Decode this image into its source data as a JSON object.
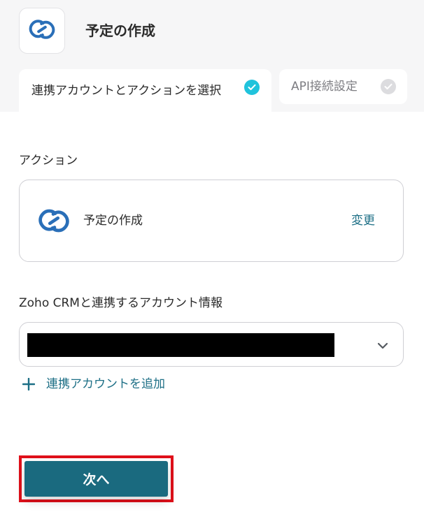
{
  "header": {
    "app_icon": "zoho-crm-icon",
    "title": "予定の作成"
  },
  "tabs": [
    {
      "label": "連携アカウントとアクションを選択",
      "state": "completed",
      "icon": "check-icon"
    },
    {
      "label": "API接続設定",
      "state": "pending",
      "icon": "check-icon"
    }
  ],
  "action_section": {
    "label": "アクション",
    "card": {
      "icon": "zoho-crm-icon",
      "action_name": "予定の作成",
      "change_label": "変更"
    }
  },
  "account_section": {
    "label": "Zoho CRMと連携するアカウント情報",
    "select": {
      "value_redacted": true,
      "icon": "chevron-down-icon"
    },
    "add_account_label": "連携アカウントを追加",
    "add_icon": "plus-icon"
  },
  "footer": {
    "next_label": "次へ"
  },
  "colors": {
    "accent": "#1a6a7f",
    "link": "#1d6f86",
    "check_active": "#20c3dc",
    "check_inactive": "#dcdcdf",
    "highlight": "#e0101a",
    "brand_icon": "#2a6fb8"
  }
}
